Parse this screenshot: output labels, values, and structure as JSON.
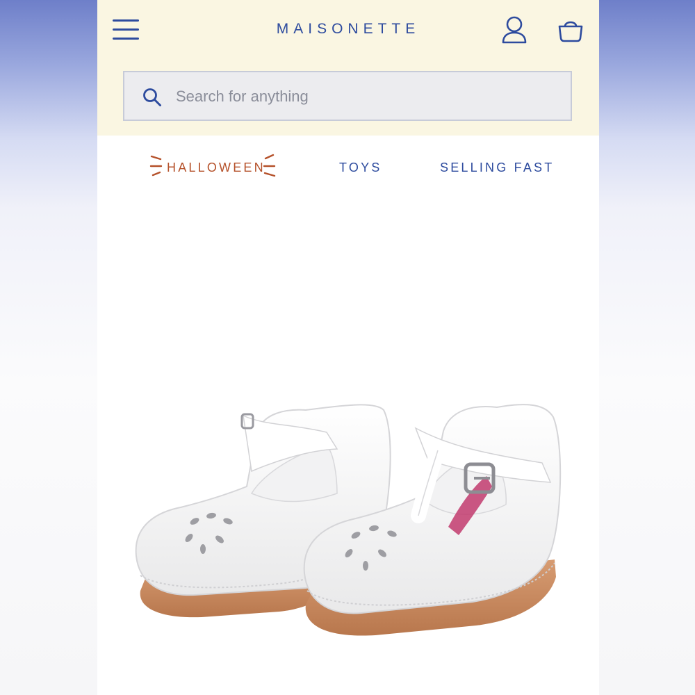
{
  "brand": {
    "name": "MAISONETTE"
  },
  "header": {
    "menu_icon": "hamburger-menu-icon",
    "account_icon": "user-account-icon",
    "bag_icon": "shopping-bag-icon",
    "brand_color": "#2d4b9e",
    "background": "#faf6e2"
  },
  "search": {
    "placeholder": "Search for anything",
    "value": "",
    "icon": "search-icon"
  },
  "nav": {
    "items": [
      {
        "label": "HALLOWEEN",
        "color": "#b5512a",
        "decoration": "sparkle-lines"
      },
      {
        "label": "TOYS",
        "color": "#2d4b9e"
      },
      {
        "label": "SELLING FAST",
        "color": "#2d4b9e"
      }
    ]
  },
  "product": {
    "image": "white-leather-t-strap-toddler-shoes"
  }
}
